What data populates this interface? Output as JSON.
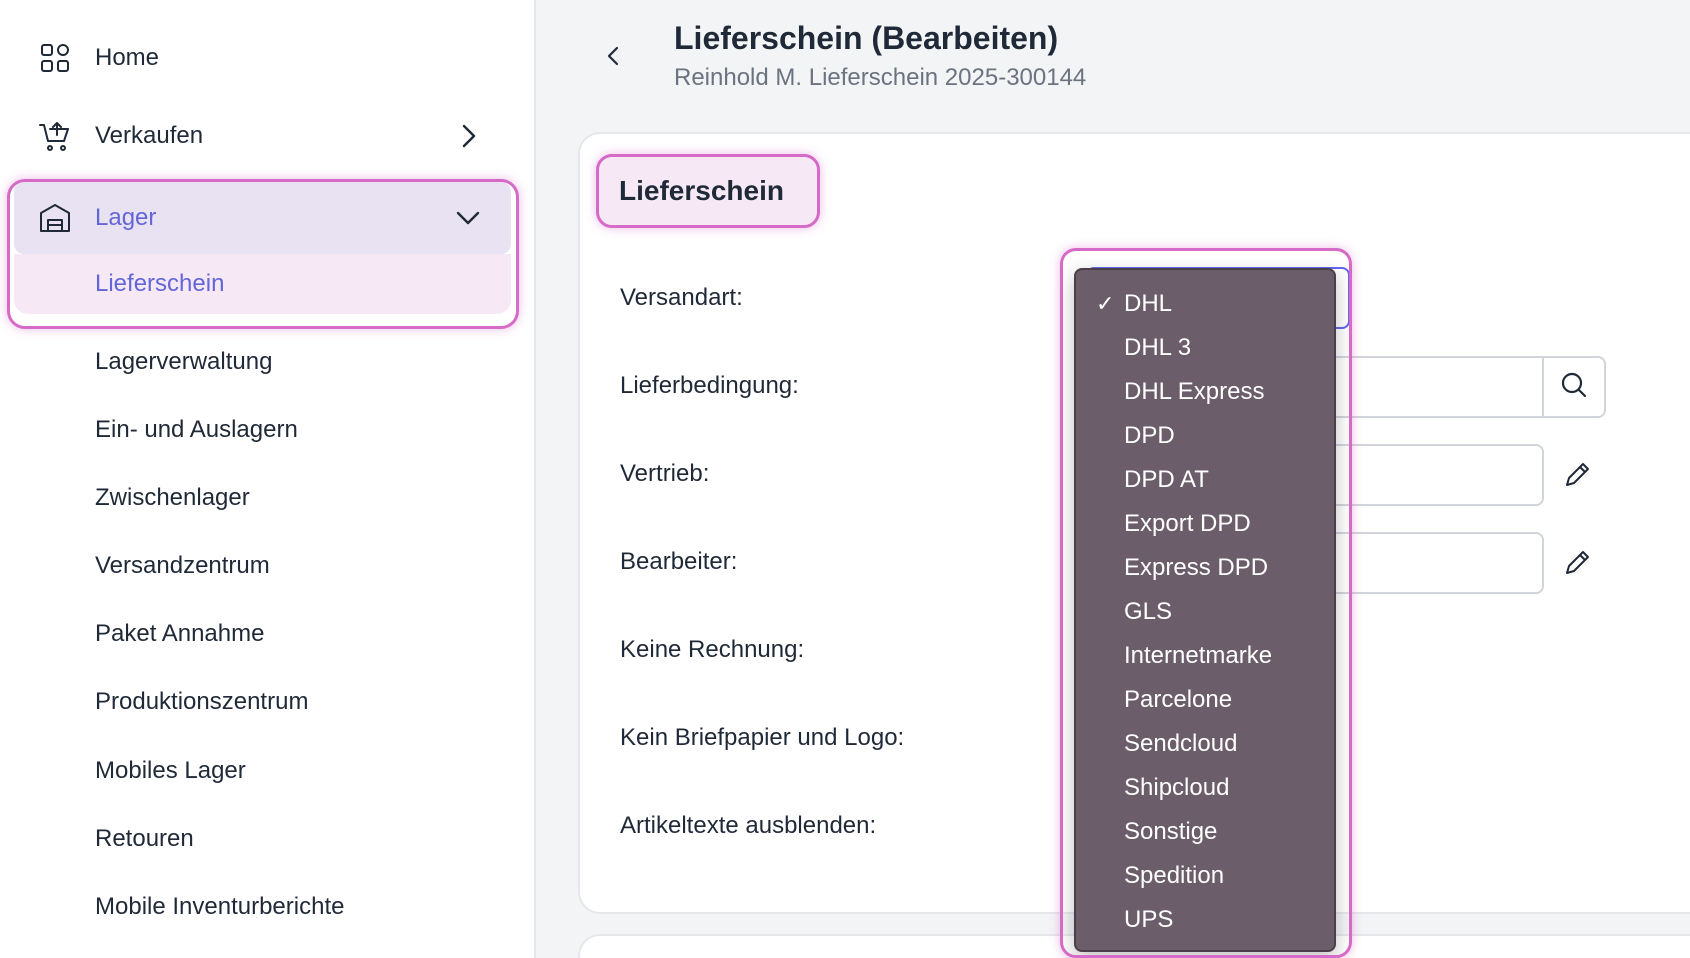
{
  "sidebar": {
    "home": {
      "label": "Home",
      "icon": "grid-icon"
    },
    "verkaufen": {
      "label": "Verkaufen",
      "icon": "cart-icon"
    },
    "lager": {
      "label": "Lager",
      "icon": "warehouse-icon",
      "expanded": true
    },
    "subitems": [
      {
        "label": "Lieferschein",
        "active": true
      },
      {
        "label": "Lagerverwaltung"
      },
      {
        "label": "Ein- und Auslagern"
      },
      {
        "label": "Zwischenlager"
      },
      {
        "label": "Versandzentrum"
      },
      {
        "label": "Paket Annahme"
      },
      {
        "label": "Produktionszentrum"
      },
      {
        "label": "Mobiles Lager"
      },
      {
        "label": "Retouren"
      },
      {
        "label": "Mobile Inventurberichte"
      }
    ]
  },
  "header": {
    "title": "Lieferschein (Bearbeiten)",
    "subtitle": "Reinhold M. Lieferschein 2025-300144"
  },
  "section": {
    "title": "Lieferschein"
  },
  "form": {
    "labels": [
      "Versandart:",
      "Lieferbedingung:",
      "Vertrieb:",
      "Bearbeiter:",
      "Keine Rechnung:",
      "Kein Briefpapier und Logo:",
      "Artikeltexte ausblenden:"
    ]
  },
  "dropdown": {
    "selected": "DHL",
    "check": "✓",
    "options": [
      "DHL",
      "DHL 3",
      "DHL Express",
      "DPD",
      "DPD AT",
      "Export DPD",
      "Express DPD",
      "GLS",
      "Internetmarke",
      "Parcelone",
      "Sendcloud",
      "Shipcloud",
      "Sonstige",
      "Spedition",
      "UPS"
    ]
  },
  "colors": {
    "accent": "#6366d8",
    "highlight": "#d56ac7",
    "dropdown_bg": "#6b5d69"
  }
}
